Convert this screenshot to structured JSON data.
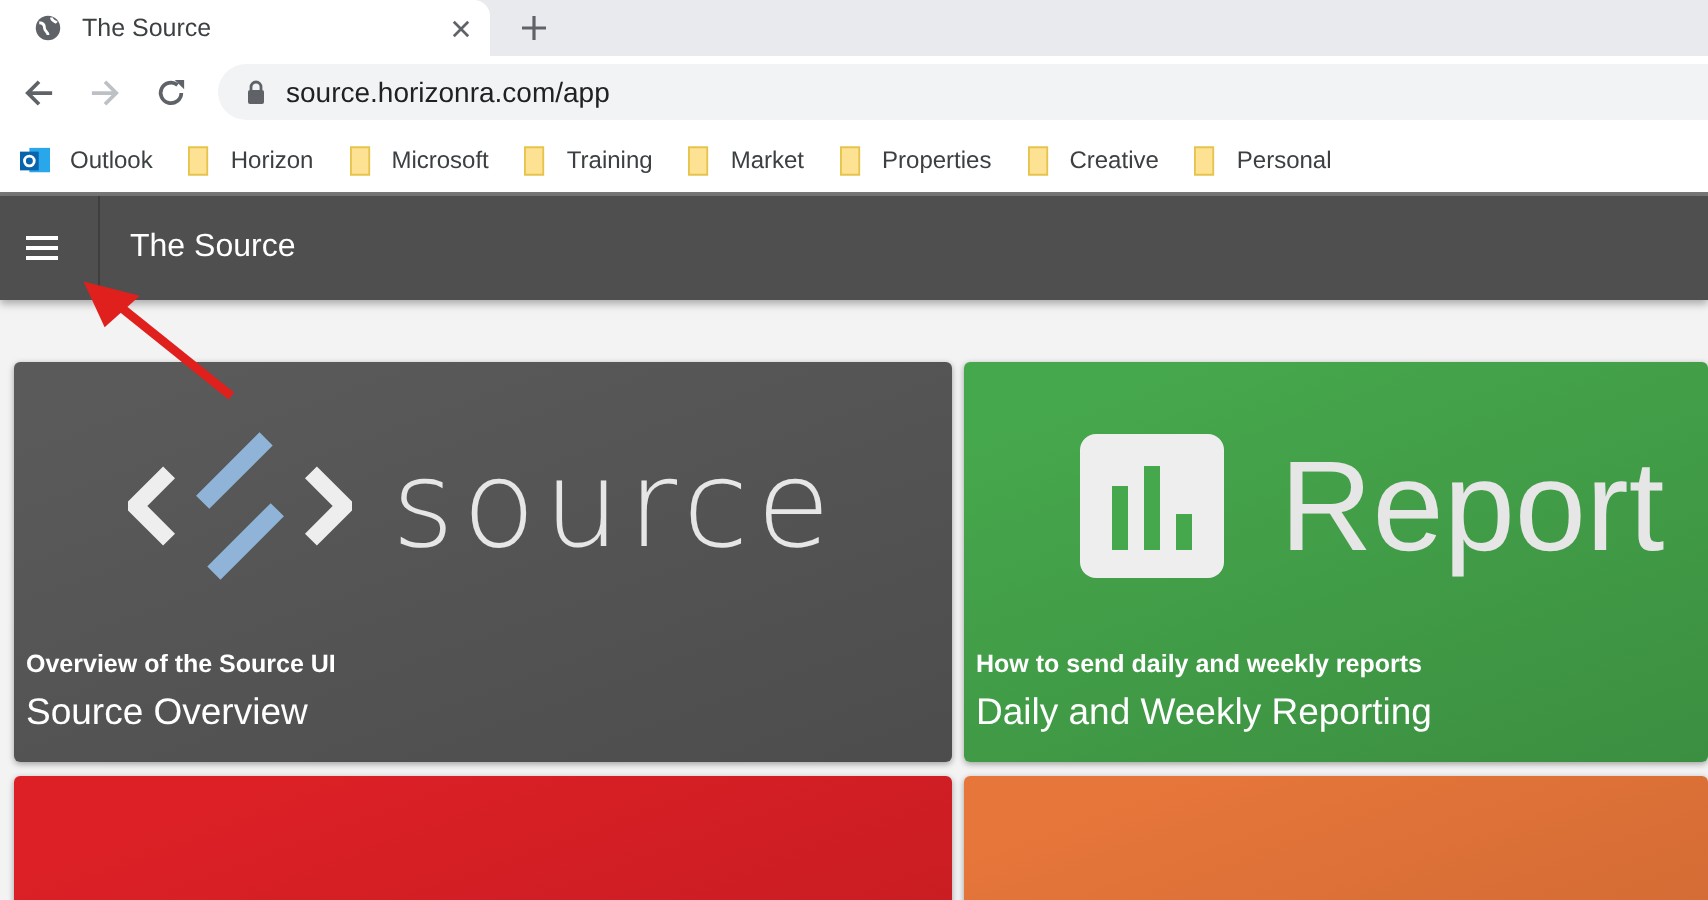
{
  "browser": {
    "tab": {
      "title": "The Source",
      "selected": true
    },
    "address": "source.horizonra.com/app",
    "bookmarks": [
      {
        "label": "Outlook",
        "kind": "outlook"
      },
      {
        "label": "Horizon",
        "kind": "folder"
      },
      {
        "label": "Microsoft",
        "kind": "folder"
      },
      {
        "label": "Training",
        "kind": "folder"
      },
      {
        "label": "Market",
        "kind": "folder"
      },
      {
        "label": "Properties",
        "kind": "folder"
      },
      {
        "label": "Creative",
        "kind": "folder"
      },
      {
        "label": "Personal",
        "kind": "folder"
      }
    ]
  },
  "app_bar": {
    "title": "The Source"
  },
  "cards": [
    {
      "kind": "source",
      "color": "#5a5a5a",
      "logo_text": "source",
      "subtitle": "Overview of the Source UI",
      "title": "Source Overview"
    },
    {
      "kind": "report",
      "color": "#46a84c",
      "logo_text": "Report",
      "subtitle": "How to send daily and weekly reports",
      "title": "Daily and Weekly Reporting"
    },
    {
      "kind": "partial-logo",
      "color": "#dd2026"
    },
    {
      "kind": "partial-chart",
      "color": "#e7763a"
    }
  ]
}
